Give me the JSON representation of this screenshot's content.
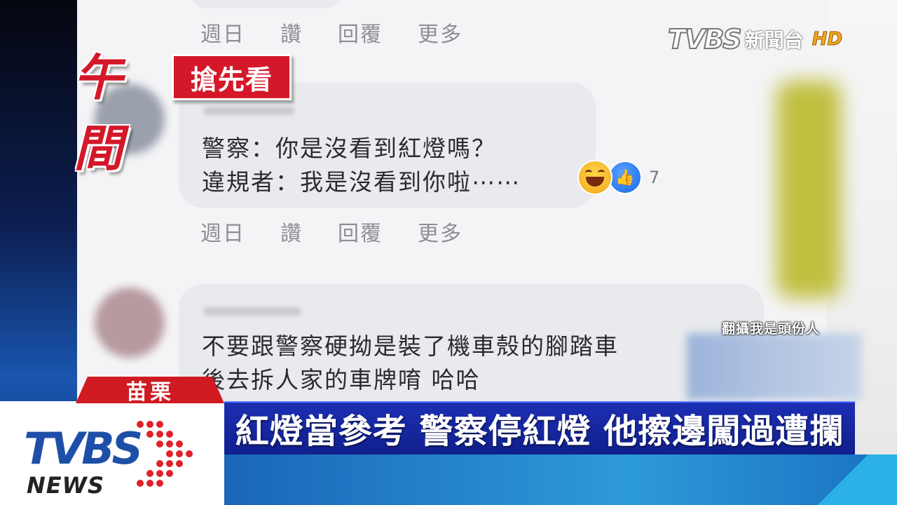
{
  "program": {
    "title_big": "午間",
    "title_tag": "搶先看"
  },
  "channel": {
    "brand": "TVBS",
    "name": "新聞台",
    "quality": "HD"
  },
  "comments": [
    {
      "meta": [
        "週日",
        "讚",
        "回覆",
        "更多"
      ]
    },
    {
      "lines": [
        "警察：你是沒看到紅燈嗎？",
        "違規者：我是沒看到你啦⋯⋯"
      ],
      "reaction_count": "7",
      "meta": [
        "週日",
        "讚",
        "回覆",
        "更多"
      ]
    },
    {
      "lines": [
        "不要跟警察硬拗是裝了機車殼的腳踏車",
        "後去拆人家的車牌唷 哈哈"
      ]
    }
  ],
  "credit": "翻攝我是頭份人",
  "lower_third": {
    "location": "苗栗",
    "headline": "紅燈當參考 警察停紅燈 他擦邊闖過遭攔",
    "logo_top": "TVBS",
    "logo_bottom": "NEWS"
  },
  "colors": {
    "accent_red": "#d4182a",
    "headline_blue": "#101f8c",
    "brand_blue": "#1e4fa8"
  }
}
